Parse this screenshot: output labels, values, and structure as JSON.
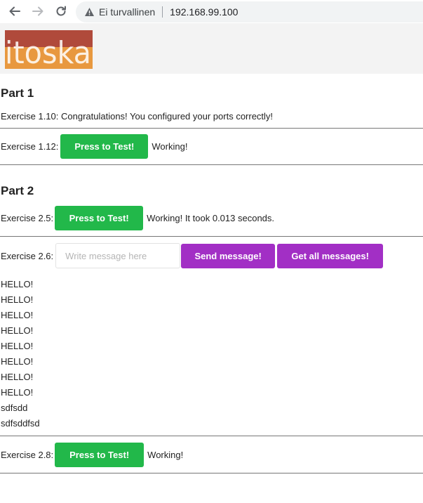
{
  "browser": {
    "security_label": "Ei turvallinen",
    "url": "192.168.99.100"
  },
  "header": {
    "logo_text": "itoska",
    "colors": {
      "logo_top": "#b04a3b",
      "logo_bottom": "#e8983f"
    }
  },
  "part1": {
    "title": "Part 1",
    "ex110_text": "Exercise 1.10: Congratulations! You configured your ports correctly!",
    "ex112_label": "Exercise 1.12:",
    "ex112_button": "Press to Test!",
    "ex112_status": "Working!"
  },
  "part2": {
    "title": "Part 2",
    "ex25_label": "Exercise 2.5:",
    "ex25_button": "Press to Test!",
    "ex25_status": "Working! It took 0.013 seconds.",
    "ex26_label": "Exercise 2.6:",
    "ex26_placeholder": "Write message here",
    "ex26_send": "Send message!",
    "ex26_get": "Get all messages!",
    "messages": [
      "HELLO!",
      "HELLO!",
      "HELLO!",
      "HELLO!",
      "HELLO!",
      "HELLO!",
      "HELLO!",
      "HELLO!",
      "sdfsdd",
      "sdfsddfsd"
    ],
    "ex28_label": "Exercise 2.8:",
    "ex28_button": "Press to Test!",
    "ex28_status": "Working!"
  },
  "colors": {
    "green": "#22b84a",
    "purple": "#a22fc5"
  }
}
